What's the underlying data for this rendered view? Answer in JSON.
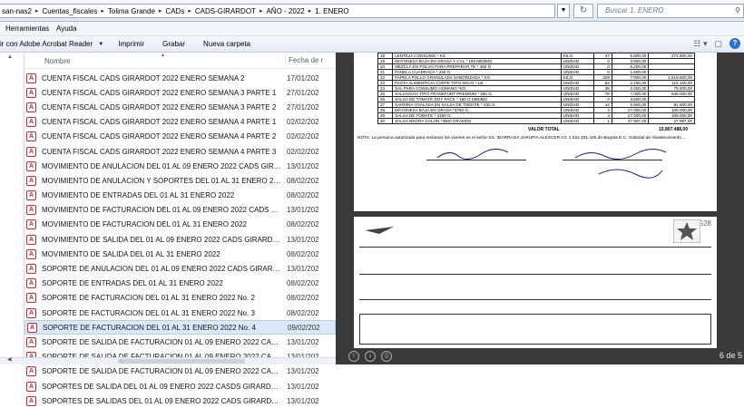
{
  "address": {
    "crumbs": [
      "san-nas2",
      "Cuentas_fiscales",
      "Tolima Grande",
      "CADs",
      "CADS-GIRARDOT",
      "AÑO - 2022",
      "1. ENERO"
    ],
    "search_placeholder": "Buscar 1. ENERO"
  },
  "menu": {
    "tools": "Herramientas",
    "help": "Ayuda"
  },
  "toolbar": {
    "open_with": "ir con Adobe Acrobat Reader",
    "print": "Imprimir",
    "burn": "Grabar",
    "new_folder": "Nueva carpeta"
  },
  "columns": {
    "name": "Nombre",
    "date": "Fecha de r"
  },
  "files": [
    {
      "name": "CUENTA FISCAL CADS GIRARDOT 2022 ENERO SEMANA 2",
      "date": "17/01/202"
    },
    {
      "name": "CUENTA FISCAL CADS GIRARDOT 2022 ENERO SEMANA 3 PARTE 1",
      "date": "27/01/202"
    },
    {
      "name": "CUENTA FISCAL CADS GIRARDOT 2022 ENERO SEMANA 3 PARTE 2",
      "date": "27/01/202"
    },
    {
      "name": "CUENTA FISCAL CADS GIRARDOT 2022 ENERO SEMANA 4 PARTE 1",
      "date": "02/02/202"
    },
    {
      "name": "CUENTA FISCAL CADS GIRARDOT 2022 ENERO SEMANA 4 PARTE 2",
      "date": "02/02/202"
    },
    {
      "name": "CUENTA FISCAL CADS GIRARDOT 2022 ENERO SEMANA 4 PARTE 3",
      "date": "02/02/202"
    },
    {
      "name": "MOVIMIENTO DE ANULACION DEL 01 AL 09 ENERO 2022 CADS GIRAR...",
      "date": "13/01/202"
    },
    {
      "name": "MOVIMIENTO DE ANULACION Y SOPORTES DEL 01 AL 31 ENERO 2022",
      "date": "08/02/202"
    },
    {
      "name": "MOVIMIENTO DE ENTRADAS DEL 01 AL 31 ENERO 2022",
      "date": "08/02/202"
    },
    {
      "name": "MOVIMIENTO DE FACTURACION DEL 01 AL 09 ENERO 2022 CADS GIR...",
      "date": "13/01/202"
    },
    {
      "name": "MOVIMIENTO DE FACTURACION DEL 01 AL 31 ENERO 2022",
      "date": "08/02/202"
    },
    {
      "name": "MOVIMIENTO DE SALIDA DEL 01 AL 09 ENERO 2022 CADS GIRARDOT",
      "date": "13/01/202"
    },
    {
      "name": "MOVIMIENTO DE SALIDA DEL 01 AL 31 ENERO 2022",
      "date": "08/02/202"
    },
    {
      "name": "SOPORTE DE ANULACION DEL 01 AL 09 ENERO 2022 CADS GIRARDOT",
      "date": "13/01/202"
    },
    {
      "name": "SOPORTE DE ENTRADAS DEL 01 AL 31 ENERO 2022",
      "date": "08/02/202"
    },
    {
      "name": "SOPORTE DE FACTURACION DEL 01 AL 31 ENERO 2022 No. 2",
      "date": "08/02/202"
    },
    {
      "name": "SOPORTE DE FACTURACION DEL 01 AL 31 ENERO 2022 No. 3",
      "date": "08/02/202"
    },
    {
      "name": "SOPORTE DE FACTURACION DEL 01 AL 31 ENERO 2022 No. 4",
      "date": "09/02/202"
    },
    {
      "name": "SOPORTE DE SALIDA DE FACTURACION 01 AL 09 ENERO 2022 CADS G...",
      "date": "13/01/202"
    },
    {
      "name": "SOPORTE DE SALIDA DE FACTURACION 01 AL 09 ENERO 2022 CADS G...",
      "date": "13/01/202"
    },
    {
      "name": "SOPORTE DE SALIDA DE FACTURACION 01 AL 09 ENERO 2022 CADS G...",
      "date": "13/01/202"
    },
    {
      "name": "SOPORTES DE SALIDA DEL 01 AL 09 ENERO 2022 CASDS GIRARDOT No...",
      "date": "13/01/202"
    },
    {
      "name": "SOPORTES DE SALIDAS DEL 01 AL 09 ENERO 2022 CADS GIRARDOT No...",
      "date": "13/01/202"
    }
  ],
  "selected_index": 17,
  "preview": {
    "table_rows": [
      [
        "18",
        "LENTEJA CONSUMO * KG",
        "KILO",
        "47",
        "5.800,00",
        "272.600,00"
      ],
      [
        "19",
        "MAYONESA BAJA EN GRASA Y CAL * 190 MINIMO",
        "UNIDAD",
        "0",
        "3.800,00",
        ""
      ],
      [
        "20",
        "MEZCLA EN POLVO PARA PREPARAR TE * 450 G",
        "UNIDAD",
        "0",
        "6.200,00",
        ""
      ],
      [
        "21",
        "PANELA CUADRADA * 250 G.",
        "UNIDAD",
        "0",
        "1.600,00",
        ""
      ],
      [
        "22",
        "PAPELA POLLO GRANULADA SABORIZADA * KG",
        "KILO",
        "208",
        "7.900,00",
        "1.619.500,00"
      ],
      [
        "23",
        "PASTA ALIMENTICIA CORTE TIPO SECO * LB",
        "UNIDAD",
        "54",
        "2.150,00",
        "116.100,00"
      ],
      [
        "24",
        "SAL PARA CONSUMO HUMANO *KG",
        "UNIDAD",
        "36",
        "2.200,00",
        "79.200,00"
      ],
      [
        "25",
        "SALCHICHA TIPO FRANKFURT PREMIUM * 360 G.",
        "UNIDAD",
        "78",
        "7.000,00",
        "546.000,00"
      ],
      [
        "26",
        "SALSA DE TOMATE DOY PACK * 180 G MINIMO",
        "UNIDAD",
        "0",
        "3.600,00",
        ""
      ],
      [
        "27",
        "SARDINA OVALADA EN SALSA DE TOMATE * 425 G.",
        "UNIDAD",
        "12",
        "6.800,00",
        "81.600,00"
      ],
      [
        "28",
        "MAYONESA BAJA EN GRASA *3750 G.",
        "UNIDAD",
        "4",
        "27.000,00",
        "108.000,00"
      ],
      [
        "29",
        "SALSA DE TOMATE * 4150 G.",
        "UNIDAD",
        "4",
        "27.000,00",
        "108.000,00"
      ],
      [
        "30",
        "SALSA NEGRA GALON *3800 GRAMOS",
        "UNIDAD",
        "1",
        "27.997,00",
        "27.997,00"
      ]
    ],
    "total_label": "VALOR TOTAL",
    "total_value": "15.807.488,00",
    "nota": "NOTA: La persona autorizada para reclamar los viveres es el señor SS. IDARRAGA JARUPIA ALEXCER CC 1.022.331.425 de Bogota D.C. Subtotal de Abastecimiento ..."
  },
  "page_info": "6 de 5"
}
